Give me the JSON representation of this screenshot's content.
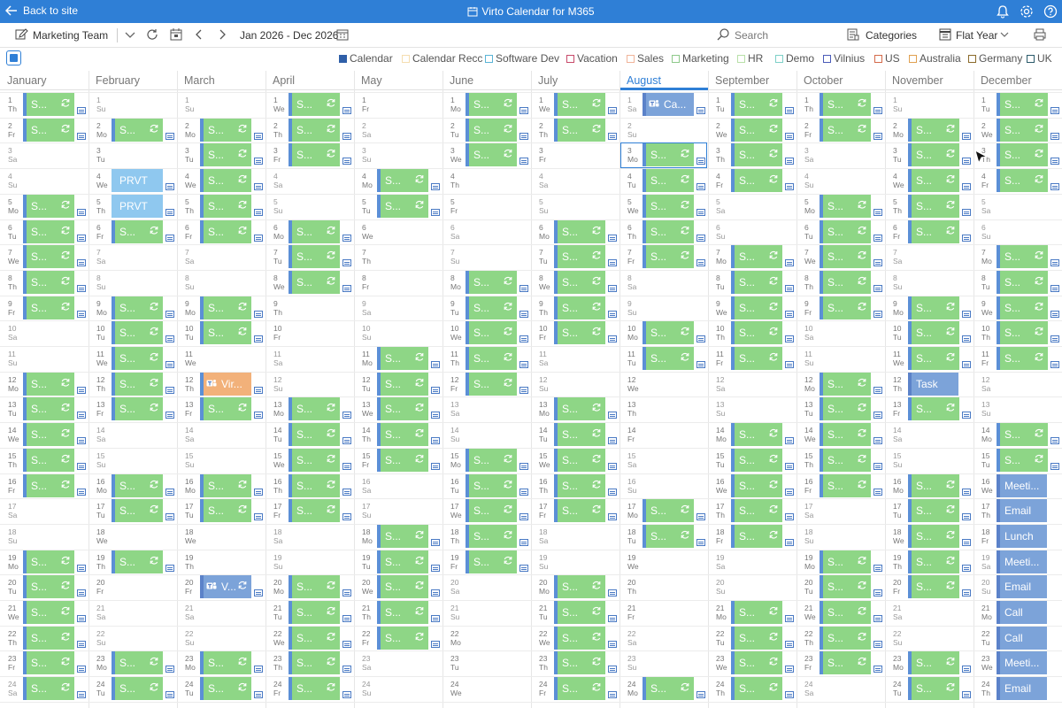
{
  "topbar": {
    "back_label": "Back to site",
    "title": "Virto Calendar for M365"
  },
  "toolbar": {
    "calendar_name": "Marketing Team",
    "date_range": "Jan 2026 - Dec 2026",
    "search_placeholder": "Search",
    "categories_label": "Categories",
    "view_label": "Flat Year"
  },
  "legend": [
    {
      "label": "Calendar",
      "color": "#2f5fa8",
      "filled": true
    },
    {
      "label": "Calendar Recc",
      "color": "#f5deb0",
      "filled": false
    },
    {
      "label": "Software Dev",
      "color": "#5ab4d6",
      "filled": false
    },
    {
      "label": "Vacation",
      "color": "#c84a6a",
      "filled": false
    },
    {
      "label": "Sales",
      "color": "#f0b49a",
      "filled": false
    },
    {
      "label": "Marketing",
      "color": "#8ec98a",
      "filled": false
    },
    {
      "label": "HR",
      "color": "#b8e0a8",
      "filled": false
    },
    {
      "label": "Demo",
      "color": "#7dd0c8",
      "filled": false
    },
    {
      "label": "Vilnius",
      "color": "#4a5bb8",
      "filled": false
    },
    {
      "label": "US",
      "color": "#d46a4a",
      "filled": false
    },
    {
      "label": "Australia",
      "color": "#e0a050",
      "filled": false
    },
    {
      "label": "Germany",
      "color": "#8a6a2a",
      "filled": false
    },
    {
      "label": "UK",
      "color": "#2a5a6a",
      "filled": false
    }
  ],
  "months": [
    "January",
    "February",
    "March",
    "April",
    "May",
    "June",
    "July",
    "August",
    "September",
    "October",
    "November",
    "December"
  ],
  "active_month": "August",
  "year": 2026,
  "weekday_abbr": [
    "Su",
    "Mo",
    "Tu",
    "We",
    "Th",
    "Fr",
    "Sa"
  ],
  "default_event_label": "S...",
  "green_events": [
    [
      1,
      2,
      5,
      6,
      7,
      8,
      9,
      12,
      13,
      14,
      15,
      16,
      19,
      20,
      21,
      22,
      23,
      24
    ],
    [
      2,
      5,
      6,
      9,
      10,
      11,
      12,
      13,
      16,
      17,
      19,
      23,
      24
    ],
    [
      2,
      3,
      4,
      5,
      6,
      9,
      10,
      13,
      16,
      17,
      23,
      24
    ],
    [
      1,
      2,
      3,
      6,
      7,
      8,
      13,
      14,
      15,
      16,
      17,
      20,
      21,
      22,
      23,
      24
    ],
    [
      4,
      5,
      11,
      12,
      13,
      14,
      15,
      18,
      19,
      20,
      21,
      22
    ],
    [
      1,
      2,
      3,
      8,
      9,
      10,
      11,
      12,
      15,
      16,
      17,
      18,
      19
    ],
    [
      1,
      2,
      6,
      7,
      8,
      9,
      10,
      13,
      14,
      15,
      16,
      17,
      20,
      21,
      22,
      23,
      24
    ],
    [
      3,
      4,
      5,
      6,
      7,
      10,
      11,
      17,
      18,
      24
    ],
    [
      1,
      2,
      3,
      4,
      7,
      8,
      9,
      10,
      11,
      14,
      15,
      16,
      17,
      18,
      21,
      22,
      23,
      24
    ],
    [
      1,
      2,
      5,
      6,
      7,
      8,
      9,
      12,
      13,
      14,
      15,
      16,
      19,
      20,
      21,
      22,
      23
    ],
    [
      2,
      3,
      4,
      5,
      6,
      9,
      10,
      11,
      13,
      16,
      17,
      18,
      19,
      20,
      23,
      24
    ],
    [
      1,
      2,
      3,
      4,
      7,
      8,
      9,
      10,
      11,
      14,
      15
    ]
  ],
  "special_events": [
    {
      "month": 2,
      "day": 4,
      "label": "PRVT",
      "style": "sky"
    },
    {
      "month": 2,
      "day": 5,
      "label": "PRVT",
      "style": "sky"
    },
    {
      "month": 3,
      "day": 12,
      "label": "Vir...",
      "style": "orange",
      "teams": true
    },
    {
      "month": 3,
      "day": 20,
      "label": "V...",
      "style": "blue",
      "teams": true,
      "recurring": true
    },
    {
      "month": 8,
      "day": 1,
      "label": "Ca...",
      "style": "blue",
      "teams": true
    },
    {
      "month": 11,
      "day": 12,
      "label": "Task",
      "style": "blue"
    },
    {
      "month": 12,
      "day": 16,
      "label": "Meeti...",
      "style": "blue"
    },
    {
      "month": 12,
      "day": 17,
      "label": "Email",
      "style": "blue"
    },
    {
      "month": 12,
      "day": 18,
      "label": "Lunch",
      "style": "blue"
    },
    {
      "month": 12,
      "day": 19,
      "label": "Meeti...",
      "style": "blue"
    },
    {
      "month": 12,
      "day": 20,
      "label": "Email",
      "style": "blue"
    },
    {
      "month": 12,
      "day": 21,
      "label": "Call",
      "style": "blue"
    },
    {
      "month": 12,
      "day": 22,
      "label": "Call",
      "style": "blue"
    },
    {
      "month": 12,
      "day": 23,
      "label": "Meeti...",
      "style": "blue"
    },
    {
      "month": 12,
      "day": 24,
      "label": "Email",
      "style": "blue"
    }
  ],
  "selected_cell": {
    "month": 8,
    "day": 3
  }
}
